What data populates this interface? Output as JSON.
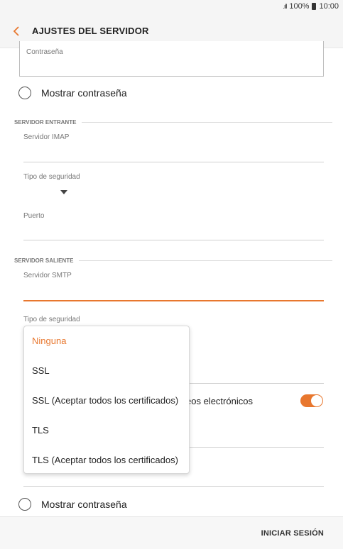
{
  "status_bar": {
    "signal": ".ıll",
    "battery": "100%",
    "time": "10:00"
  },
  "header": {
    "title": "AJUSTES DEL SERVIDOR",
    "back_icon": "chevron-left-icon"
  },
  "account": {
    "password_label": "Contraseña",
    "show_password_label": "Mostrar contraseña",
    "show_password_checked": false
  },
  "incoming": {
    "section_title": "SERVIDOR ENTRANTE",
    "imap_label": "Servidor IMAP",
    "imap_value": "",
    "security_label": "Tipo de seguridad",
    "port_label": "Puerto",
    "port_value": ""
  },
  "outgoing": {
    "section_title": "SERVIDOR SALIENTE",
    "smtp_label": "Servidor SMTP",
    "smtp_value": "",
    "security_label": "Tipo de seguridad",
    "partial_toggle_text": "eos electrónicos",
    "toggle_on": true,
    "show_password_label": "Mostrar contraseña",
    "show_password_checked": false
  },
  "security_dropdown": {
    "selected": "Ninguna",
    "options": [
      "Ninguna",
      "SSL",
      "SSL (Aceptar todos los certificados)",
      "TLS",
      "TLS (Aceptar todos los certificados)"
    ]
  },
  "footer": {
    "signin_label": "INICIAR SESIÓN"
  },
  "colors": {
    "accent": "#e8772e",
    "bar_bg": "#f5f5f5",
    "text": "#212121",
    "muted": "#777777"
  }
}
